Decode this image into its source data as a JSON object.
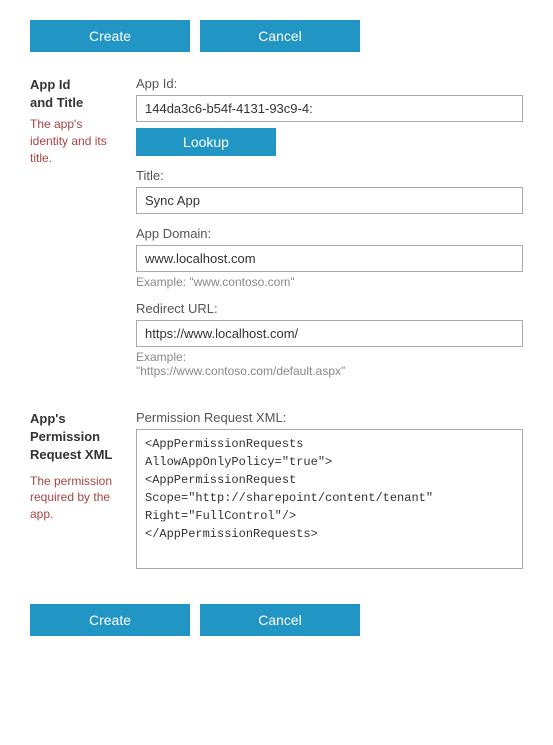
{
  "toolbar_top": {
    "create_label": "Create",
    "cancel_label": "Cancel"
  },
  "toolbar_bottom": {
    "create_label": "Create",
    "cancel_label": "Cancel"
  },
  "section_app_id": {
    "title": "App Id\nand Title",
    "description": "The app's identity and its title.",
    "app_id_label": "App Id:",
    "app_id_value": "144da3c6-b54f-4131-93c9-4:",
    "lookup_label": "Lookup",
    "title_label": "Title:",
    "title_value": "Sync App",
    "app_domain_label": "App Domain:",
    "app_domain_value": "www.localhost.com",
    "app_domain_example": "Example: \"www.contoso.com\"",
    "redirect_url_label": "Redirect URL:",
    "redirect_url_value": "https://www.localhost.com/",
    "redirect_url_example": "Example:\n\"https://www.contoso.com/default.aspx\""
  },
  "section_permission": {
    "title": "App's Permission Request XML",
    "description": "The permission required by the app.",
    "xml_label": "Permission Request XML:",
    "xml_value": "<AppPermissionRequests\nAllowAppOnlyPolicy=\"true\">\n<AppPermissionRequest\nScope=\"http://sharepoint/content/tenant\"\nRight=\"FullControl\"/>\n</AppPermissionRequests>"
  }
}
